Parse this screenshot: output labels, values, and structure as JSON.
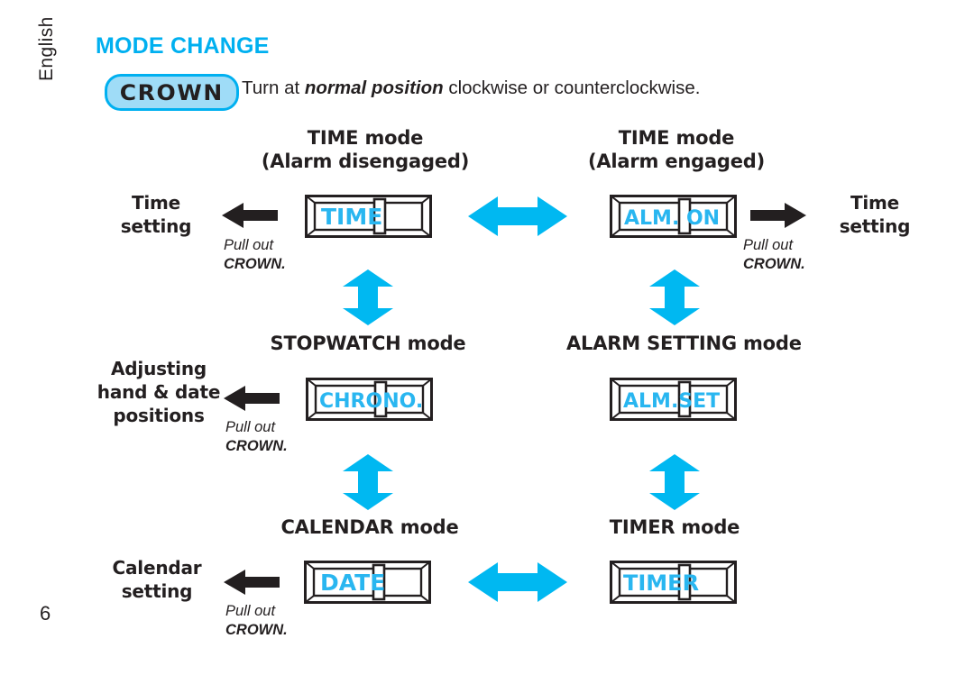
{
  "page": {
    "language_tab": "English",
    "number": "6",
    "accent_color": "#00b0f0",
    "lcd_color": "#29b6f0",
    "pill_fill": "#9fdcf7"
  },
  "header": {
    "title": "MODE CHANGE",
    "crown_pill": "CROWN",
    "instruction_before": "Turn at ",
    "instruction_emphasis": "normal position",
    "instruction_after": " clockwise or counterclockwise."
  },
  "pullout_caption": {
    "line1": "Pull out",
    "line2": "CROWN."
  },
  "modes": [
    {
      "id": "time-alarm-disengaged",
      "heading_line1": "TIME mode",
      "heading_line2": "(Alarm disengaged)",
      "lcd": "TIME"
    },
    {
      "id": "time-alarm-engaged",
      "heading_line1": "TIME mode",
      "heading_line2": "(Alarm engaged)",
      "lcd": "ALM. ON"
    },
    {
      "id": "stopwatch",
      "heading_line1": "STOPWATCH mode",
      "heading_line2": "",
      "lcd": "CHRONO."
    },
    {
      "id": "alarm-setting",
      "heading_line1": "ALARM SETTING mode",
      "heading_line2": "",
      "lcd": "ALM.SET"
    },
    {
      "id": "calendar",
      "heading_line1": "CALENDAR mode",
      "heading_line2": "",
      "lcd": "DATE"
    },
    {
      "id": "timer",
      "heading_line1": "TIMER mode",
      "heading_line2": "",
      "lcd": "TIMER"
    }
  ],
  "side_labels": {
    "time_setting_left_line1": "Time",
    "time_setting_left_line2": "setting",
    "time_setting_right_line1": "Time",
    "time_setting_right_line2": "setting",
    "adjusting_line1": "Adjusting",
    "adjusting_line2": "hand & date",
    "adjusting_line3": "positions",
    "calendar_line1": "Calendar",
    "calendar_line2": "setting"
  }
}
